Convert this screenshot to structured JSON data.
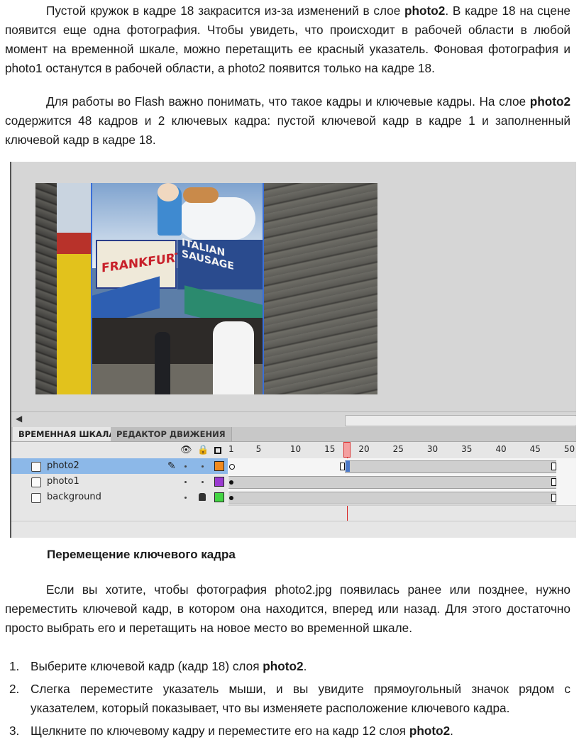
{
  "paragraphs": {
    "p1": {
      "a": "Пустой кружок в кадре 18 закрасится из-за изменений в слое ",
      "b": "photo2",
      "c": ". В кадре 18 на сцене появится еще одна фотография. Чтобы увидеть, что происходит в рабочей области в любой момент на временной шкале, можно перетащить ее красный указатель. Фоновая фотография и photo1 останутся в рабочей области, а photo2 появится только на кадре 18."
    },
    "p2": {
      "a": "Для работы во Flash важно понимать, что такое кадры и ключевые кадры. На слое ",
      "b": "photo2",
      "c": " содержится 48 кадров и 2 ключевых кадра: пустой ключевой кадр в кадре 1 и заполненный ключевой кадр в кадре 18."
    },
    "p3": "Если вы хотите, чтобы фотография photo2.jpg появилась ранее или позднее, нужно переместить ключевой кадр, в котором она находится, вперед или назад. Для этого достаточно просто выбрать его и перетащить на новое место во временной шкале."
  },
  "heading": "Перемещение ключевого кадра",
  "steps": [
    {
      "num": "1.",
      "a": "Выберите ключевой кадр (кадр 18) слоя ",
      "b": "photo2",
      "c": "."
    },
    {
      "num": "2.",
      "a": "Слегка переместите указатель мыши, и вы увидите прямоугольный значок рядом с указателем, который показывает, что вы изменяете расположение ключевого кадра.",
      "b": "",
      "c": ""
    },
    {
      "num": "3.",
      "a": "Щелкните по ключевому кадру и переместите его на кадр 12 слоя ",
      "b": "photo2",
      "c": "."
    }
  ],
  "screenshot": {
    "sign_left": "FRANKFURTERS",
    "sign_right": "ITALIAN SAUSAGE",
    "tabs": {
      "timeline": "ВРЕМЕННАЯ ШКАЛА",
      "motion_editor": "РЕДАКТОР ДВИЖЕНИЯ"
    },
    "ruler": [
      "1",
      "5",
      "10",
      "15",
      "20",
      "25",
      "30",
      "35",
      "40",
      "45",
      "50"
    ],
    "playhead_frame": 18,
    "layers": [
      {
        "name": "photo2",
        "selected": true,
        "color": "#f08a1e",
        "keyframes": [
          1,
          18
        ],
        "frames": 48
      },
      {
        "name": "photo1",
        "selected": false,
        "color": "#9a3ad0",
        "keyframes": [
          1
        ],
        "frames": 48
      },
      {
        "name": "background",
        "selected": false,
        "color": "#44d444",
        "keyframes": [
          1
        ],
        "frames": 48,
        "locked": true
      }
    ],
    "colors": {
      "selected_layer": "#8cb8e8",
      "playhead": "#d62222"
    }
  }
}
